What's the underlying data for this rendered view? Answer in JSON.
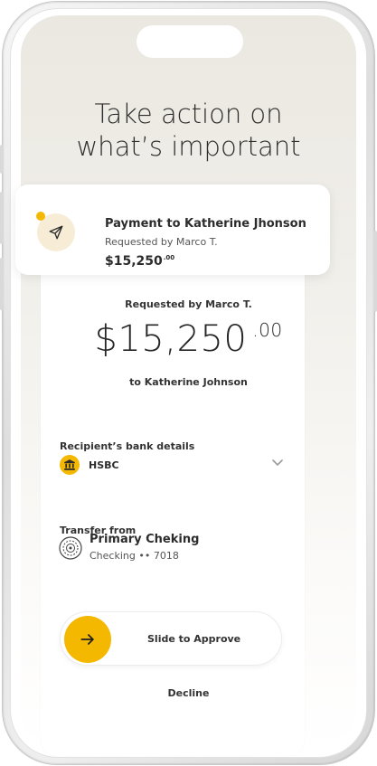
{
  "headline": {
    "line1": "Take action on",
    "line2": "what’s important"
  },
  "notification": {
    "title": "Payment to Katherine Jhonson",
    "subtitle": "Requested by Marco T.",
    "amount": "$15,250",
    "amount_cents": ".00",
    "icon": "send-icon",
    "badge_color": "#f5b800"
  },
  "request": {
    "requested_by": "Requested by Marco T.",
    "amount": "$15,250",
    "amount_cents": ".00",
    "recipient": "to Katherine Johnson"
  },
  "bank_details": {
    "label": "Recipient’s bank details",
    "bank_name": "HSBC",
    "icon": "bank-icon"
  },
  "transfer_from": {
    "label": "Transfer from",
    "account_name": "Primary Cheking",
    "account_type": "Checking",
    "account_mask": "•• 7018"
  },
  "actions": {
    "slide_label": "Slide to Approve",
    "decline_label": "Decline"
  },
  "colors": {
    "accent": "#f5b800",
    "text": "#2c2c2c"
  }
}
